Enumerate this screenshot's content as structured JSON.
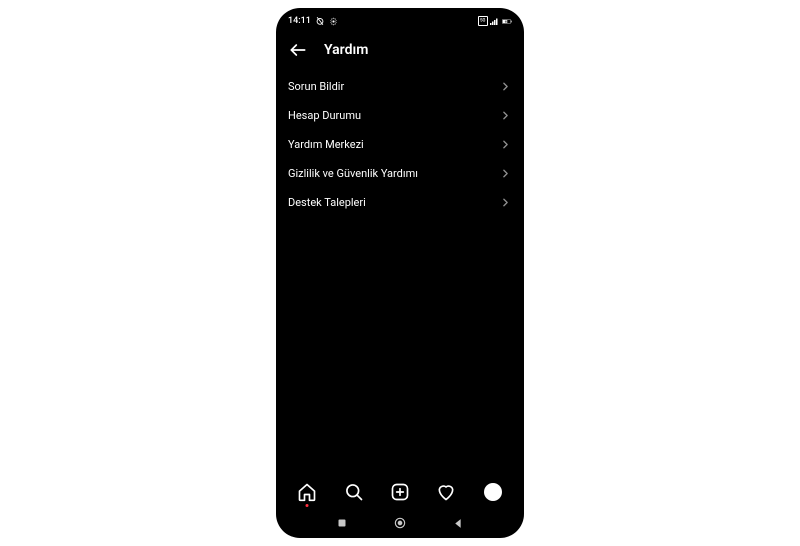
{
  "status": {
    "time": "14:11",
    "network_label": "5G",
    "battery": "60"
  },
  "header": {
    "title": "Yardım"
  },
  "menu": {
    "items": [
      {
        "label": "Sorun Bildir"
      },
      {
        "label": "Hesap Durumu"
      },
      {
        "label": "Yardım Merkezi"
      },
      {
        "label": "Gizlilik ve Güvenlik Yardımı"
      },
      {
        "label": "Destek Talepleri"
      }
    ]
  }
}
